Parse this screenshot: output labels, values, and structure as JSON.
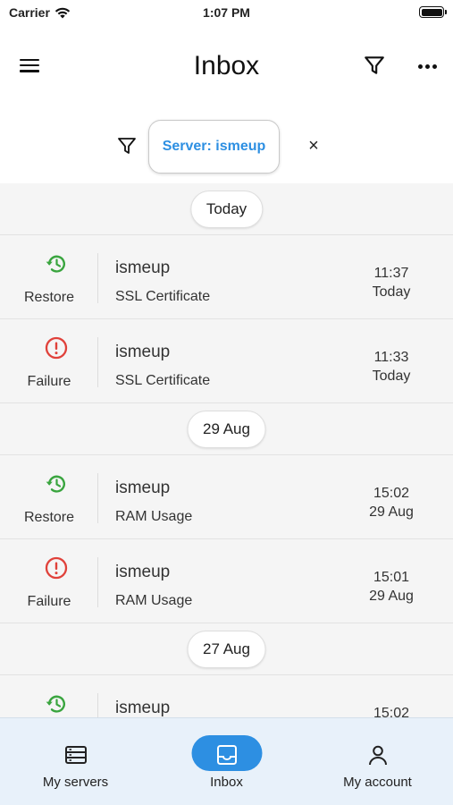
{
  "status_bar": {
    "carrier": "Carrier",
    "time": "1:07 PM"
  },
  "header": {
    "title": "Inbox"
  },
  "filter": {
    "chip_label": "Server: ismeup",
    "close_glyph": "×"
  },
  "list": [
    {
      "kind": "date",
      "label": "Today"
    },
    {
      "kind": "item",
      "status": "Restore",
      "icon": "restore-icon",
      "server": "ismeup",
      "service": "SSL Certificate",
      "time": "11:37",
      "day": "Today"
    },
    {
      "kind": "item",
      "status": "Failure",
      "icon": "failure-icon",
      "server": "ismeup",
      "service": "SSL Certificate",
      "time": "11:33",
      "day": "Today"
    },
    {
      "kind": "date",
      "label": "29 Aug"
    },
    {
      "kind": "item",
      "status": "Restore",
      "icon": "restore-icon",
      "server": "ismeup",
      "service": "RAM Usage",
      "time": "15:02",
      "day": "29 Aug"
    },
    {
      "kind": "item",
      "status": "Failure",
      "icon": "failure-icon",
      "server": "ismeup",
      "service": "RAM Usage",
      "time": "15:01",
      "day": "29 Aug"
    },
    {
      "kind": "date",
      "label": "27 Aug"
    },
    {
      "kind": "item",
      "status": "",
      "icon": "restore-icon",
      "server": "ismeup",
      "service": "",
      "time": "15:02",
      "day": ""
    }
  ],
  "bottom_nav": [
    {
      "label": "My servers",
      "icon": "servers-icon",
      "active": false
    },
    {
      "label": "Inbox",
      "icon": "inbox-icon",
      "active": true
    },
    {
      "label": "My account",
      "icon": "account-icon",
      "active": false
    }
  ],
  "colors": {
    "accent": "#2d8fe2",
    "restore": "#3aa53f",
    "failure": "#e0413a",
    "nav_bg": "#e8f1fa"
  }
}
